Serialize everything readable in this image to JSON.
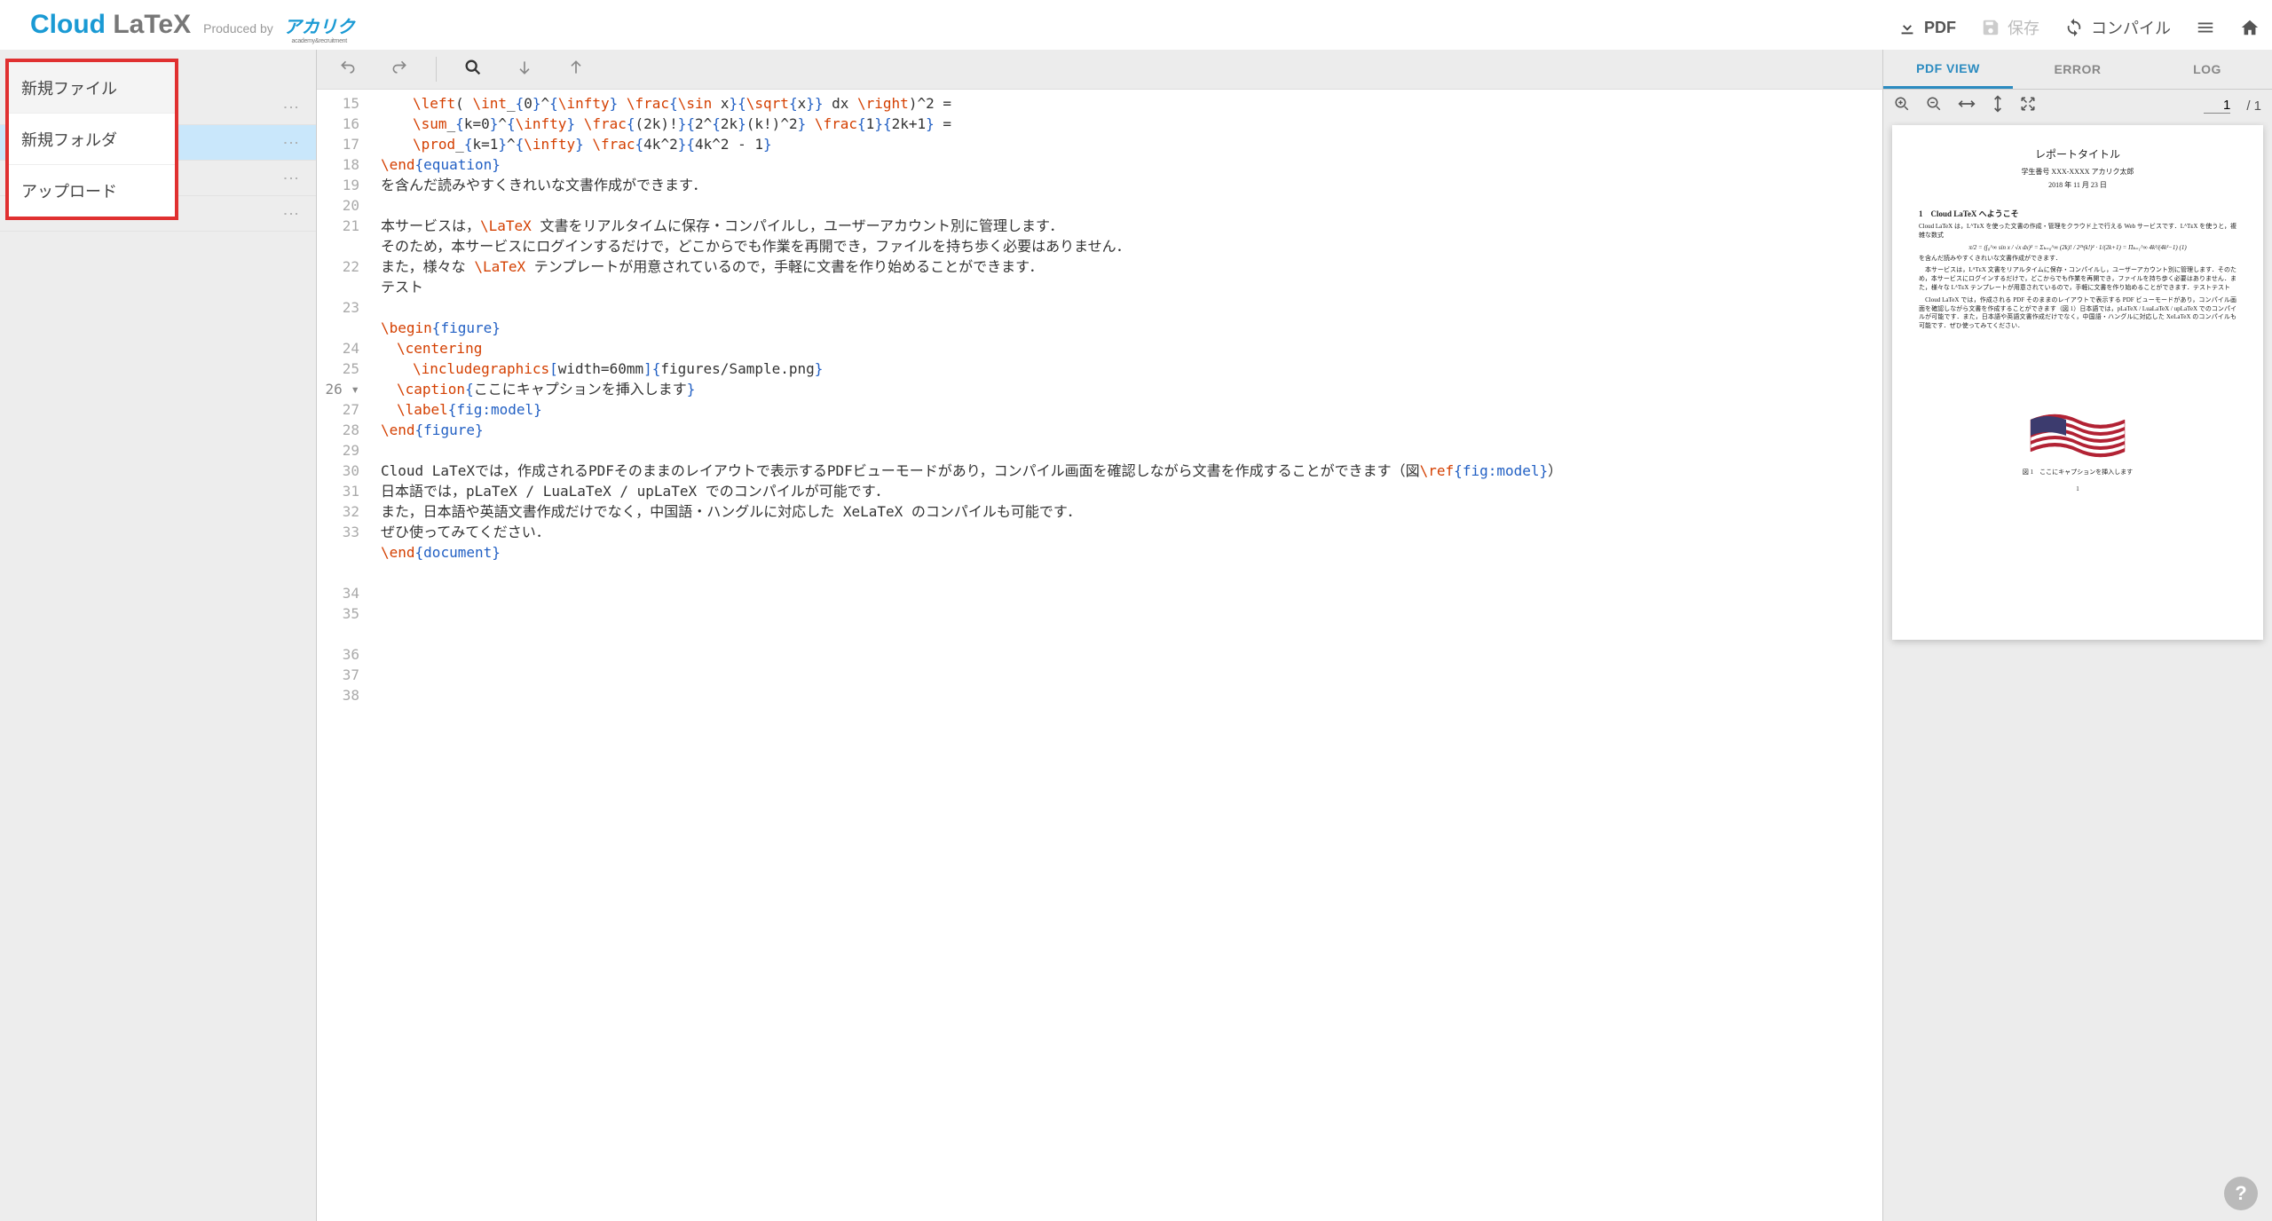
{
  "brand": {
    "cloud": "Cloud",
    "latex": " LaTeX",
    "producedby": "Produced by",
    "acaric": "アカリク",
    "acaric_sub": "academy&recruitment"
  },
  "topbar": {
    "pdf": "PDF",
    "save": "保存",
    "compile": "コンパイル"
  },
  "context_menu": {
    "new_file": "新規ファイル",
    "new_folder": "新規フォルダ",
    "upload": "アップロード"
  },
  "editor": {
    "lines": [
      {
        "n": 15,
        "indent": 2,
        "segs": [
          {
            "c": "tok-cmd",
            "t": "\\left"
          },
          {
            "c": "",
            "t": "( "
          },
          {
            "c": "tok-cmd",
            "t": "\\int"
          },
          {
            "c": "",
            "t": "_"
          },
          {
            "c": "tok-brace",
            "t": "{"
          },
          {
            "c": "",
            "t": "0"
          },
          {
            "c": "tok-brace",
            "t": "}"
          },
          {
            "c": "",
            "t": "^"
          },
          {
            "c": "tok-brace",
            "t": "{"
          },
          {
            "c": "tok-cmd",
            "t": "\\infty"
          },
          {
            "c": "tok-brace",
            "t": "}"
          },
          {
            "c": "",
            "t": " "
          },
          {
            "c": "tok-cmd",
            "t": "\\frac"
          },
          {
            "c": "tok-brace",
            "t": "{"
          },
          {
            "c": "tok-cmd",
            "t": "\\sin"
          },
          {
            "c": "",
            "t": " x"
          },
          {
            "c": "tok-brace",
            "t": "}{"
          },
          {
            "c": "tok-cmd",
            "t": "\\sqrt"
          },
          {
            "c": "tok-brace",
            "t": "{"
          },
          {
            "c": "",
            "t": "x"
          },
          {
            "c": "tok-brace",
            "t": "}}"
          },
          {
            "c": "",
            "t": " dx "
          },
          {
            "c": "tok-cmd",
            "t": "\\right"
          },
          {
            "c": "",
            "t": ")^2 ="
          }
        ]
      },
      {
        "n": 16,
        "indent": 2,
        "segs": [
          {
            "c": "tok-cmd",
            "t": "\\sum"
          },
          {
            "c": "",
            "t": "_"
          },
          {
            "c": "tok-brace",
            "t": "{"
          },
          {
            "c": "",
            "t": "k=0"
          },
          {
            "c": "tok-brace",
            "t": "}"
          },
          {
            "c": "",
            "t": "^"
          },
          {
            "c": "tok-brace",
            "t": "{"
          },
          {
            "c": "tok-cmd",
            "t": "\\infty"
          },
          {
            "c": "tok-brace",
            "t": "}"
          },
          {
            "c": "",
            "t": " "
          },
          {
            "c": "tok-cmd",
            "t": "\\frac"
          },
          {
            "c": "tok-brace",
            "t": "{"
          },
          {
            "c": "",
            "t": "(2k)!"
          },
          {
            "c": "tok-brace",
            "t": "}{"
          },
          {
            "c": "",
            "t": "2^"
          },
          {
            "c": "tok-brace",
            "t": "{"
          },
          {
            "c": "",
            "t": "2k"
          },
          {
            "c": "tok-brace",
            "t": "}"
          },
          {
            "c": "",
            "t": "(k!)^2"
          },
          {
            "c": "tok-brace",
            "t": "}"
          },
          {
            "c": "",
            "t": " "
          },
          {
            "c": "tok-cmd",
            "t": "\\frac"
          },
          {
            "c": "tok-brace",
            "t": "{"
          },
          {
            "c": "",
            "t": "1"
          },
          {
            "c": "tok-brace",
            "t": "}{"
          },
          {
            "c": "",
            "t": "2k+1"
          },
          {
            "c": "tok-brace",
            "t": "}"
          },
          {
            "c": "",
            "t": " ="
          }
        ]
      },
      {
        "n": 17,
        "indent": 2,
        "segs": [
          {
            "c": "tok-cmd",
            "t": "\\prod"
          },
          {
            "c": "",
            "t": "_"
          },
          {
            "c": "tok-brace",
            "t": "{"
          },
          {
            "c": "",
            "t": "k=1"
          },
          {
            "c": "tok-brace",
            "t": "}"
          },
          {
            "c": "",
            "t": "^"
          },
          {
            "c": "tok-brace",
            "t": "{"
          },
          {
            "c": "tok-cmd",
            "t": "\\infty"
          },
          {
            "c": "tok-brace",
            "t": "}"
          },
          {
            "c": "",
            "t": " "
          },
          {
            "c": "tok-cmd",
            "t": "\\frac"
          },
          {
            "c": "tok-brace",
            "t": "{"
          },
          {
            "c": "",
            "t": "4k^2"
          },
          {
            "c": "tok-brace",
            "t": "}{"
          },
          {
            "c": "",
            "t": "4k^2 - 1"
          },
          {
            "c": "tok-brace",
            "t": "}"
          }
        ]
      },
      {
        "n": 18,
        "indent": 0,
        "segs": [
          {
            "c": "tok-cmd",
            "t": "\\end"
          },
          {
            "c": "tok-brace",
            "t": "{"
          },
          {
            "c": "tok-param",
            "t": "equation"
          },
          {
            "c": "tok-brace",
            "t": "}"
          }
        ]
      },
      {
        "n": 19,
        "indent": 0,
        "segs": [
          {
            "c": "",
            "t": "を含んだ読みやすくきれいな文書作成ができます．"
          }
        ]
      },
      {
        "n": 20,
        "indent": 0,
        "segs": [
          {
            "c": "",
            "t": ""
          }
        ]
      },
      {
        "n": 21,
        "indent": 0,
        "wrap": true,
        "segs": [
          {
            "c": "",
            "t": "本サービスは，"
          },
          {
            "c": "tok-cmd",
            "t": "\\LaTeX"
          },
          {
            "c": "",
            "t": " 文書をリアルタイムに保存・コンパイルし，ユーザーアカウント別に管理します．"
          }
        ]
      },
      {
        "n": 22,
        "indent": 0,
        "wrap": true,
        "segs": [
          {
            "c": "",
            "t": "そのため，本サービスにログインするだけで，どこからでも作業を再開でき，ファイルを持ち歩く必要はありません．"
          }
        ]
      },
      {
        "n": 23,
        "indent": 0,
        "wrap": true,
        "segs": [
          {
            "c": "",
            "t": "また，様々な "
          },
          {
            "c": "tok-cmd",
            "t": "\\LaTeX"
          },
          {
            "c": "",
            "t": " テンプレートが用意されているので，手軽に文書を作り始めることができます．"
          }
        ]
      },
      {
        "n": 24,
        "indent": 0,
        "segs": [
          {
            "c": "",
            "t": "テスト"
          }
        ]
      },
      {
        "n": 25,
        "indent": 0,
        "segs": [
          {
            "c": "",
            "t": ""
          }
        ]
      },
      {
        "n": 26,
        "indent": 0,
        "fold": true,
        "segs": [
          {
            "c": "tok-cmd",
            "t": "\\begin"
          },
          {
            "c": "tok-brace",
            "t": "{"
          },
          {
            "c": "tok-param",
            "t": "figure"
          },
          {
            "c": "tok-brace",
            "t": "}"
          }
        ]
      },
      {
        "n": 27,
        "indent": 1,
        "segs": [
          {
            "c": "tok-cmd",
            "t": "\\centering"
          }
        ]
      },
      {
        "n": 28,
        "indent": 2,
        "segs": [
          {
            "c": "tok-cmd",
            "t": "\\includegraphics"
          },
          {
            "c": "tok-bracket",
            "t": "["
          },
          {
            "c": "",
            "t": "width=60mm"
          },
          {
            "c": "tok-bracket",
            "t": "]"
          },
          {
            "c": "tok-brace",
            "t": "{"
          },
          {
            "c": "",
            "t": "figures/Sample.png"
          },
          {
            "c": "tok-brace",
            "t": "}"
          }
        ]
      },
      {
        "n": 29,
        "indent": 1,
        "segs": [
          {
            "c": "tok-cmd",
            "t": "\\caption"
          },
          {
            "c": "tok-brace",
            "t": "{"
          },
          {
            "c": "",
            "t": "ここにキャプションを挿入します"
          },
          {
            "c": "tok-brace",
            "t": "}"
          }
        ]
      },
      {
        "n": 30,
        "indent": 1,
        "segs": [
          {
            "c": "tok-cmd",
            "t": "\\label"
          },
          {
            "c": "tok-brace",
            "t": "{"
          },
          {
            "c": "tok-param",
            "t": "fig:model"
          },
          {
            "c": "tok-brace",
            "t": "}"
          }
        ]
      },
      {
        "n": 31,
        "indent": 0,
        "segs": [
          {
            "c": "tok-cmd",
            "t": "\\end"
          },
          {
            "c": "tok-brace",
            "t": "{"
          },
          {
            "c": "tok-param",
            "t": "figure"
          },
          {
            "c": "tok-brace",
            "t": "}"
          }
        ]
      },
      {
        "n": 32,
        "indent": 0,
        "segs": [
          {
            "c": "",
            "t": ""
          }
        ]
      },
      {
        "n": 33,
        "indent": 0,
        "wrap": true,
        "segs": [
          {
            "c": "",
            "t": "Cloud LaTeXでは，作成されるPDFそのままのレイアウトで表示するPDFビューモードがあり，コンパイル画面を確認しながら文書を作成することができます（図"
          },
          {
            "c": "tok-cmd",
            "t": "\\ref"
          },
          {
            "c": "tok-brace",
            "t": "{"
          },
          {
            "c": "tok-param",
            "t": "fig:model"
          },
          {
            "c": "tok-brace",
            "t": "}"
          },
          {
            "c": "",
            "t": "）"
          }
        ]
      },
      {
        "n": 34,
        "indent": 0,
        "segs": [
          {
            "c": "",
            "t": "日本語では，pLaTeX / LuaLaTeX / upLaTeX でのコンパイルが可能です．"
          }
        ]
      },
      {
        "n": 35,
        "indent": 0,
        "wrap": true,
        "segs": [
          {
            "c": "",
            "t": "また，日本語や英語文書作成だけでなく，中国語・ハングルに対応した XeLaTeX のコンパイルも可能です．"
          }
        ]
      },
      {
        "n": 36,
        "indent": 0,
        "segs": [
          {
            "c": "",
            "t": "ぜひ使ってみてください．"
          }
        ]
      },
      {
        "n": 37,
        "indent": 0,
        "segs": [
          {
            "c": "tok-cmd",
            "t": "\\end"
          },
          {
            "c": "tok-brace",
            "t": "{"
          },
          {
            "c": "tok-param",
            "t": "document"
          },
          {
            "c": "tok-brace",
            "t": "}"
          }
        ]
      },
      {
        "n": 38,
        "indent": 0,
        "segs": [
          {
            "c": "",
            "t": ""
          }
        ]
      }
    ]
  },
  "pdf_tabs": {
    "view": "PDF VIEW",
    "error": "ERROR",
    "log": "LOG"
  },
  "pdf_toolbar": {
    "page": "1",
    "total": "/ 1"
  },
  "pdf_preview": {
    "title": "レポートタイトル",
    "author": "学生番号 XXX-XXXX アカリク太郎",
    "date": "2018 年 11 月 23 日",
    "h1": "1　Cloud LaTeX へようこそ",
    "p1": "Cloud LaTeX は，LᴬTᴇX を使った文書の作成・管理をクラウド上で行える Web サービスです．LᴬTᴇX を使うと，複雑な数式",
    "eq": "π/2 = (∫₀^∞ sin x / √x dx)² = Σₖ₌₀^∞ (2k)! / 2²ᵏ(k!)² · 1/(2k+1) = Πₖ₌₁^∞ 4k²/(4k²−1)   (1)",
    "p2": "を含んだ読みやすくきれいな文書作成ができます．",
    "p3": "　本サービスは，LᴬTᴇX 文書をリアルタイムに保存・コンパイルし，ユーザーアカウント別に管理します．そのため，本サービスにログインするだけで，どこからでも作業を再開でき，ファイルを持ち歩く必要はありません．また，様々な LᴬTᴇX テンプレートが用意されているので，手軽に文書を作り始めることができます．テストテスト",
    "p4": "　Cloud LaTeX では，作成される PDF そのままのレイアウトで表示する PDF ビューモードがあり，コンパイル画面を確認しながら文書を作成することができます（図 1）日本語では，pLaTeX / LuaLaTeX / upLaTeX でのコンパイルが可能です．また，日本語や英語文書作成だけでなく，中国語・ハングルに対応した XeLaTeX のコンパイルも可能です．ぜひ使ってみてください．",
    "caption": "図 1　ここにキャプションを挿入します",
    "pgnum": "1"
  },
  "help": "?"
}
